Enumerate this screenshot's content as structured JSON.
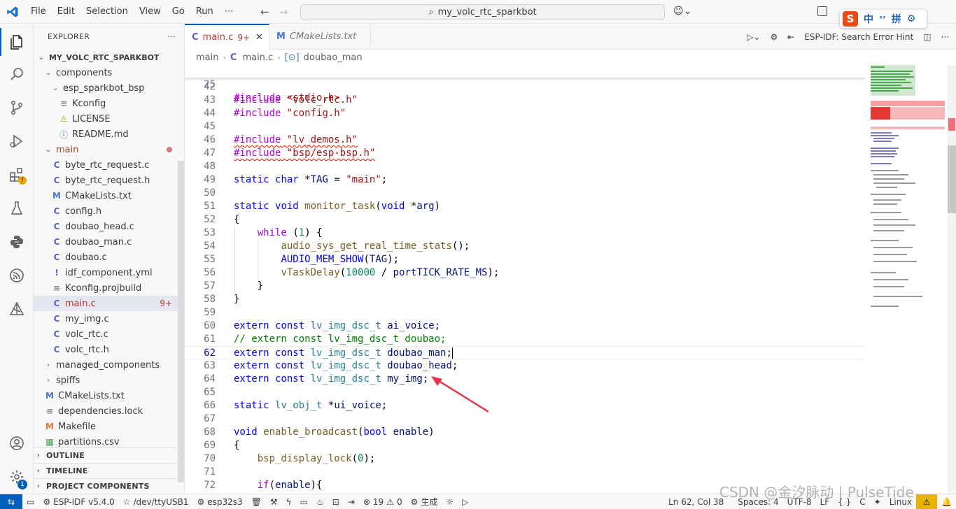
{
  "titlebar": {
    "menu": [
      "File",
      "Edit",
      "Selection",
      "View",
      "Go",
      "Run",
      "⋯"
    ],
    "search_text": "my_volc_rtc_sparkbot",
    "ime": {
      "lang": "中",
      "punct": "°’",
      "mode": "拼"
    }
  },
  "explorer": {
    "title": "EXPLORER",
    "more": "···",
    "root": "MY_VOLC_RTC_SPARKBOT",
    "items": [
      {
        "label": "components",
        "type": "folder-open",
        "indent": 0
      },
      {
        "label": "esp_sparkbot_bsp",
        "type": "folder-open",
        "indent": 1
      },
      {
        "label": "Kconfig",
        "type": "kconfig",
        "indent": 2
      },
      {
        "label": "LICENSE",
        "type": "license",
        "indent": 2
      },
      {
        "label": "README.md",
        "type": "info",
        "indent": 2
      },
      {
        "label": "main",
        "type": "folder-open-mod",
        "indent": 0
      },
      {
        "label": "byte_rtc_request.c",
        "type": "c",
        "indent": 1
      },
      {
        "label": "byte_rtc_request.h",
        "type": "c",
        "indent": 1
      },
      {
        "label": "CMakeLists.txt",
        "type": "m",
        "indent": 1
      },
      {
        "label": "config.h",
        "type": "c",
        "indent": 1
      },
      {
        "label": "doubao_head.c",
        "type": "c",
        "indent": 1
      },
      {
        "label": "doubao_man.c",
        "type": "c",
        "indent": 1
      },
      {
        "label": "doubao.c",
        "type": "c",
        "indent": 1
      },
      {
        "label": "idf_component.yml",
        "type": "yml",
        "indent": 1
      },
      {
        "label": "Kconfig.projbuild",
        "type": "kconfig",
        "indent": 1
      },
      {
        "label": "main.c",
        "type": "c-err",
        "indent": 1,
        "badge": "9+"
      },
      {
        "label": "my_img.c",
        "type": "c",
        "indent": 1
      },
      {
        "label": "volc_rtc.c",
        "type": "c",
        "indent": 1
      },
      {
        "label": "volc_rtc.h",
        "type": "c",
        "indent": 1
      },
      {
        "label": "managed_components",
        "type": "folder-closed",
        "indent": 0
      },
      {
        "label": "spiffs",
        "type": "folder-closed",
        "indent": 0
      },
      {
        "label": "CMakeLists.txt",
        "type": "m",
        "indent": 0
      },
      {
        "label": "dependencies.lock",
        "type": "lock",
        "indent": 0
      },
      {
        "label": "Makefile",
        "type": "makefile",
        "indent": 0
      },
      {
        "label": "partitions.csv",
        "type": "csv",
        "indent": 0
      }
    ],
    "sections": [
      "OUTLINE",
      "TIMELINE",
      "PROJECT COMPONENTS"
    ]
  },
  "tabs": [
    {
      "label": "main.c",
      "badge": "9+",
      "active": true
    },
    {
      "label": "CMakeLists.txt",
      "active": false
    }
  ],
  "tab_actions": {
    "hint": "ESP-IDF: Search Error Hint"
  },
  "breadcrumb": [
    "main",
    "main.c",
    "doubao_man"
  ],
  "code": {
    "sticky": {
      "num": "25",
      "text": "#include <stdio.h>"
    },
    "lines": [
      {
        "num": "42",
        "text": ""
      },
      {
        "num": "43",
        "text": "#include \"volc_rtc.h\""
      },
      {
        "num": "44",
        "text": "#include \"config.h\""
      },
      {
        "num": "45",
        "text": ""
      },
      {
        "num": "46",
        "text": "#include \"lv_demos.h\""
      },
      {
        "num": "47",
        "text": "#include \"bsp/esp-bsp.h\""
      },
      {
        "num": "48",
        "text": ""
      },
      {
        "num": "49",
        "text": "static char *TAG = \"main\";"
      },
      {
        "num": "50",
        "text": ""
      },
      {
        "num": "51",
        "text": "static void monitor_task(void *arg)"
      },
      {
        "num": "52",
        "text": "{"
      },
      {
        "num": "53",
        "text": "    while (1) {"
      },
      {
        "num": "54",
        "text": "        audio_sys_get_real_time_stats();"
      },
      {
        "num": "55",
        "text": "        AUDIO_MEM_SHOW(TAG);"
      },
      {
        "num": "56",
        "text": "        vTaskDelay(10000 / portTICK_RATE_MS);"
      },
      {
        "num": "57",
        "text": "    }"
      },
      {
        "num": "58",
        "text": "}"
      },
      {
        "num": "59",
        "text": ""
      },
      {
        "num": "60",
        "text": "extern const lv_img_dsc_t ai_voice;"
      },
      {
        "num": "61",
        "text": "// extern const lv_img_dsc_t doubao;"
      },
      {
        "num": "62",
        "text": "extern const lv_img_dsc_t doubao_man;"
      },
      {
        "num": "63",
        "text": "extern const lv_img_dsc_t doubao_head;"
      },
      {
        "num": "64",
        "text": "extern const lv_img_dsc_t my_img;"
      },
      {
        "num": "65",
        "text": ""
      },
      {
        "num": "66",
        "text": "static lv_obj_t *ui_voice;"
      },
      {
        "num": "67",
        "text": ""
      },
      {
        "num": "68",
        "text": "void enable_broadcast(bool enable)"
      },
      {
        "num": "69",
        "text": "{"
      },
      {
        "num": "70",
        "text": "    bsp_display_lock(0);"
      },
      {
        "num": "71",
        "text": ""
      },
      {
        "num": "72",
        "text": "    if(enable){"
      }
    ]
  },
  "statusbar": {
    "idf": "ESP-IDF v5.4.0",
    "port": "/dev/ttyUSB1",
    "target": "esp32s3",
    "problems_errors": "19",
    "problems_warnings": "0",
    "build": "生成",
    "position": "Ln 62, Col 38",
    "spaces": "Spaces: 4",
    "encoding": "UTF-8",
    "eol": "LF",
    "lang": "C",
    "os": "Linux"
  },
  "watermark": "CSDN @金汐脉动 | PulseTide",
  "colors": {
    "accent": "#005fb8",
    "error": "#e51400",
    "warning": "#e8b400"
  }
}
